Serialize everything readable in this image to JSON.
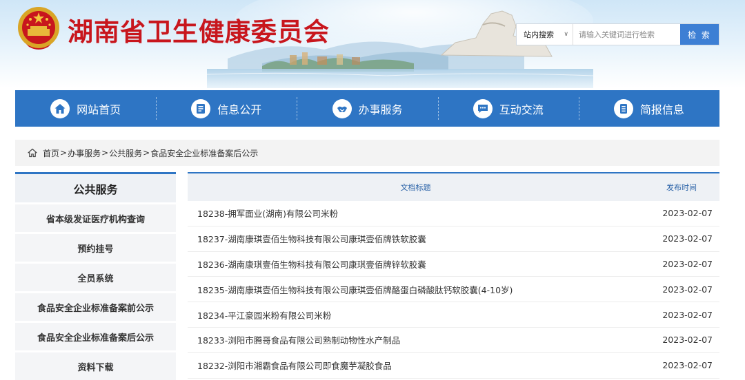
{
  "header": {
    "site_title": "湖南省卫生健康委员会",
    "search": {
      "scope": "站内搜索",
      "placeholder": "请输入关键词进行检索",
      "button": "检 索"
    }
  },
  "nav": [
    {
      "label": "网站首页",
      "icon": "home-icon"
    },
    {
      "label": "信息公开",
      "icon": "document-icon"
    },
    {
      "label": "办事服务",
      "icon": "handshake-icon"
    },
    {
      "label": "互动交流",
      "icon": "chat-icon"
    },
    {
      "label": "简报信息",
      "icon": "briefing-icon"
    }
  ],
  "breadcrumb": {
    "items": [
      "首页",
      "办事服务",
      "公共服务"
    ],
    "current": "食品安全企业标准备案后公示",
    "separator": ">"
  },
  "sidebar": {
    "title": "公共服务",
    "items": [
      "省本级发证医疗机构查询",
      "预约挂号",
      "全员系统",
      "食品安全企业标准备案前公示",
      "食品安全企业标准备案后公示",
      "资料下载"
    ]
  },
  "table": {
    "columns": {
      "title": "文档标题",
      "date": "发布时间"
    },
    "rows": [
      {
        "title": "18238-拥军面业(湖南)有限公司米粉",
        "date": "2023-02-07"
      },
      {
        "title": "18237-湖南康琪壹佰生物科技有限公司康琪壹佰牌铁软胶囊",
        "date": "2023-02-07"
      },
      {
        "title": "18236-湖南康琪壹佰生物科技有限公司康琪壹佰牌锌软胶囊",
        "date": "2023-02-07"
      },
      {
        "title": "18235-湖南康琪壹佰生物科技有限公司康琪壹佰牌酪蛋白磷酸肽钙软胶囊(4-10岁)",
        "date": "2023-02-07"
      },
      {
        "title": "18234-平江豪园米粉有限公司米粉",
        "date": "2023-02-07"
      },
      {
        "title": "18233-浏阳市腾哥食品有限公司熟制动物性水产制品",
        "date": "2023-02-07"
      },
      {
        "title": "18232-浏阳市湘霸食品有限公司即食魔芋凝胶食品",
        "date": "2023-02-07"
      }
    ]
  },
  "colors": {
    "brand_blue": "#2e75c4",
    "title_red": "#c8161d",
    "search_button": "#3d7fd4"
  }
}
